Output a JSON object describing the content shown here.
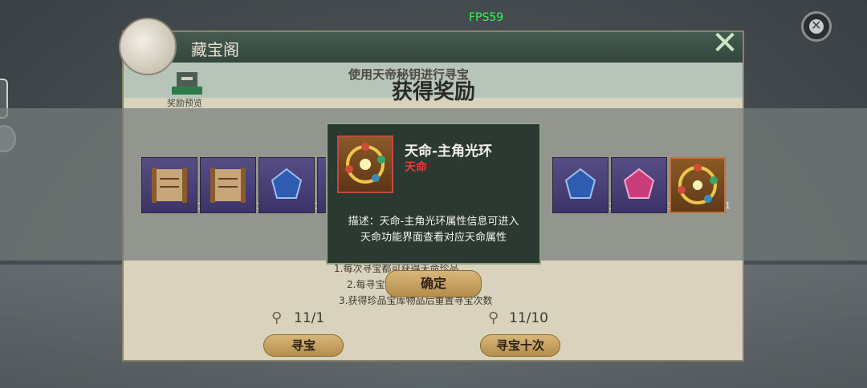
{
  "hud": {
    "fps": "FPS59"
  },
  "panel": {
    "title": "藏宝阁",
    "subtitle": "使用天帝秘钥进行寻宝",
    "preview_label": "奖励预览",
    "rules": [
      "1.每次寻宝都可获得天命珍品",
      "2.每寻宝",
      "3.获得珍品宝库物品后重置寻宝次数"
    ],
    "single": {
      "count": "11/1",
      "button": "寻宝"
    },
    "ten": {
      "count": "11/10",
      "button": "寻宝十次"
    }
  },
  "reward": {
    "title": "获得奖励",
    "items": [
      {
        "icon": "scroll-icon",
        "count": "1"
      },
      {
        "icon": "scroll-icon",
        "count": "1"
      },
      {
        "icon": "blue-gem-icon",
        "count": "1"
      },
      {
        "icon": "purple-item-icon",
        "count": "1"
      },
      {
        "icon": "blue-gem-icon",
        "count": "1"
      },
      {
        "icon": "pink-gem-icon",
        "count": "1"
      },
      {
        "icon": "golden-halo-icon",
        "count": "1"
      }
    ],
    "confirm_label": "确定"
  },
  "tooltip": {
    "name": "天命-主角光环",
    "type": "天命",
    "description_line1": "描述：天命-主角光环属性信息可进入",
    "description_line2": "天命功能界面查看对应天命属性"
  },
  "colors": {
    "tooltip_bg": "#2c3931",
    "type_red": "#e43a3a",
    "button_gold": "#c9a561"
  }
}
